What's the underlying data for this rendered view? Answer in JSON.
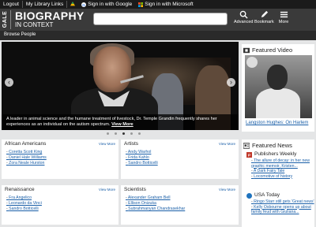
{
  "topbar": {
    "logout": "Logout",
    "library_links": "My Library Links",
    "google": "Sign in with Google",
    "microsoft": "Sign in with Microsoft"
  },
  "brand": {
    "gale": "GALE",
    "title_line1": "BIOGRAPHY",
    "title_line2": "IN CONTEXT"
  },
  "header_buttons": {
    "advanced": "Advanced",
    "bookmark": "Bookmark",
    "more": "More"
  },
  "subnav": {
    "browse": "Browse People"
  },
  "hero": {
    "caption": "A leader in animal science and the humane treatment of livestock, Dr. Temple Grandin frequently shares her experiences as an individual on the autism spectrum.",
    "view_more": "View More",
    "slide_count": 5,
    "active_slide": 3
  },
  "categories": [
    {
      "title": "African Americans",
      "view_more": "View More",
      "items": [
        "Coretta Scott King",
        "Daniel Hale Williams",
        "Zora Neale Hurston"
      ]
    },
    {
      "title": "Artists",
      "view_more": "View More",
      "items": [
        "Andy Warhol",
        "Frida Kahlo",
        "Sandro Botticelli"
      ]
    },
    {
      "title": "Renaissance",
      "view_more": "View More",
      "items": [
        "Fra Angelico",
        "Leonardo da Vinci",
        "Sandro Botticelli"
      ]
    },
    {
      "title": "Scientists",
      "view_more": "View More",
      "items": [
        "Alexander Graham Bell",
        "Ellison Onizuka",
        "Subrahmanyan Chandrasekhar"
      ]
    }
  ],
  "featured_video": {
    "title": "Featured Video",
    "caption": "Langston Hughes: On Harlem"
  },
  "featured_news": {
    "title": "Featured News",
    "sources": [
      {
        "name": "Publishers Weekly",
        "items": [
          "The allure of decay: in her new graphic memoir, Kristen...",
          "A Dark Fairy Tale",
          "Locomotive of history"
        ]
      },
      {
        "name": "USA Today",
        "items": [
          "Ringo Starr still gets 'Great news'",
          "Kelly Osbourne opens up about family feud with Giuliana..."
        ]
      }
    ]
  },
  "colors": {
    "link": "#1a5fa8",
    "header": "#3a3a3a",
    "topbar": "#1b1b1b"
  }
}
